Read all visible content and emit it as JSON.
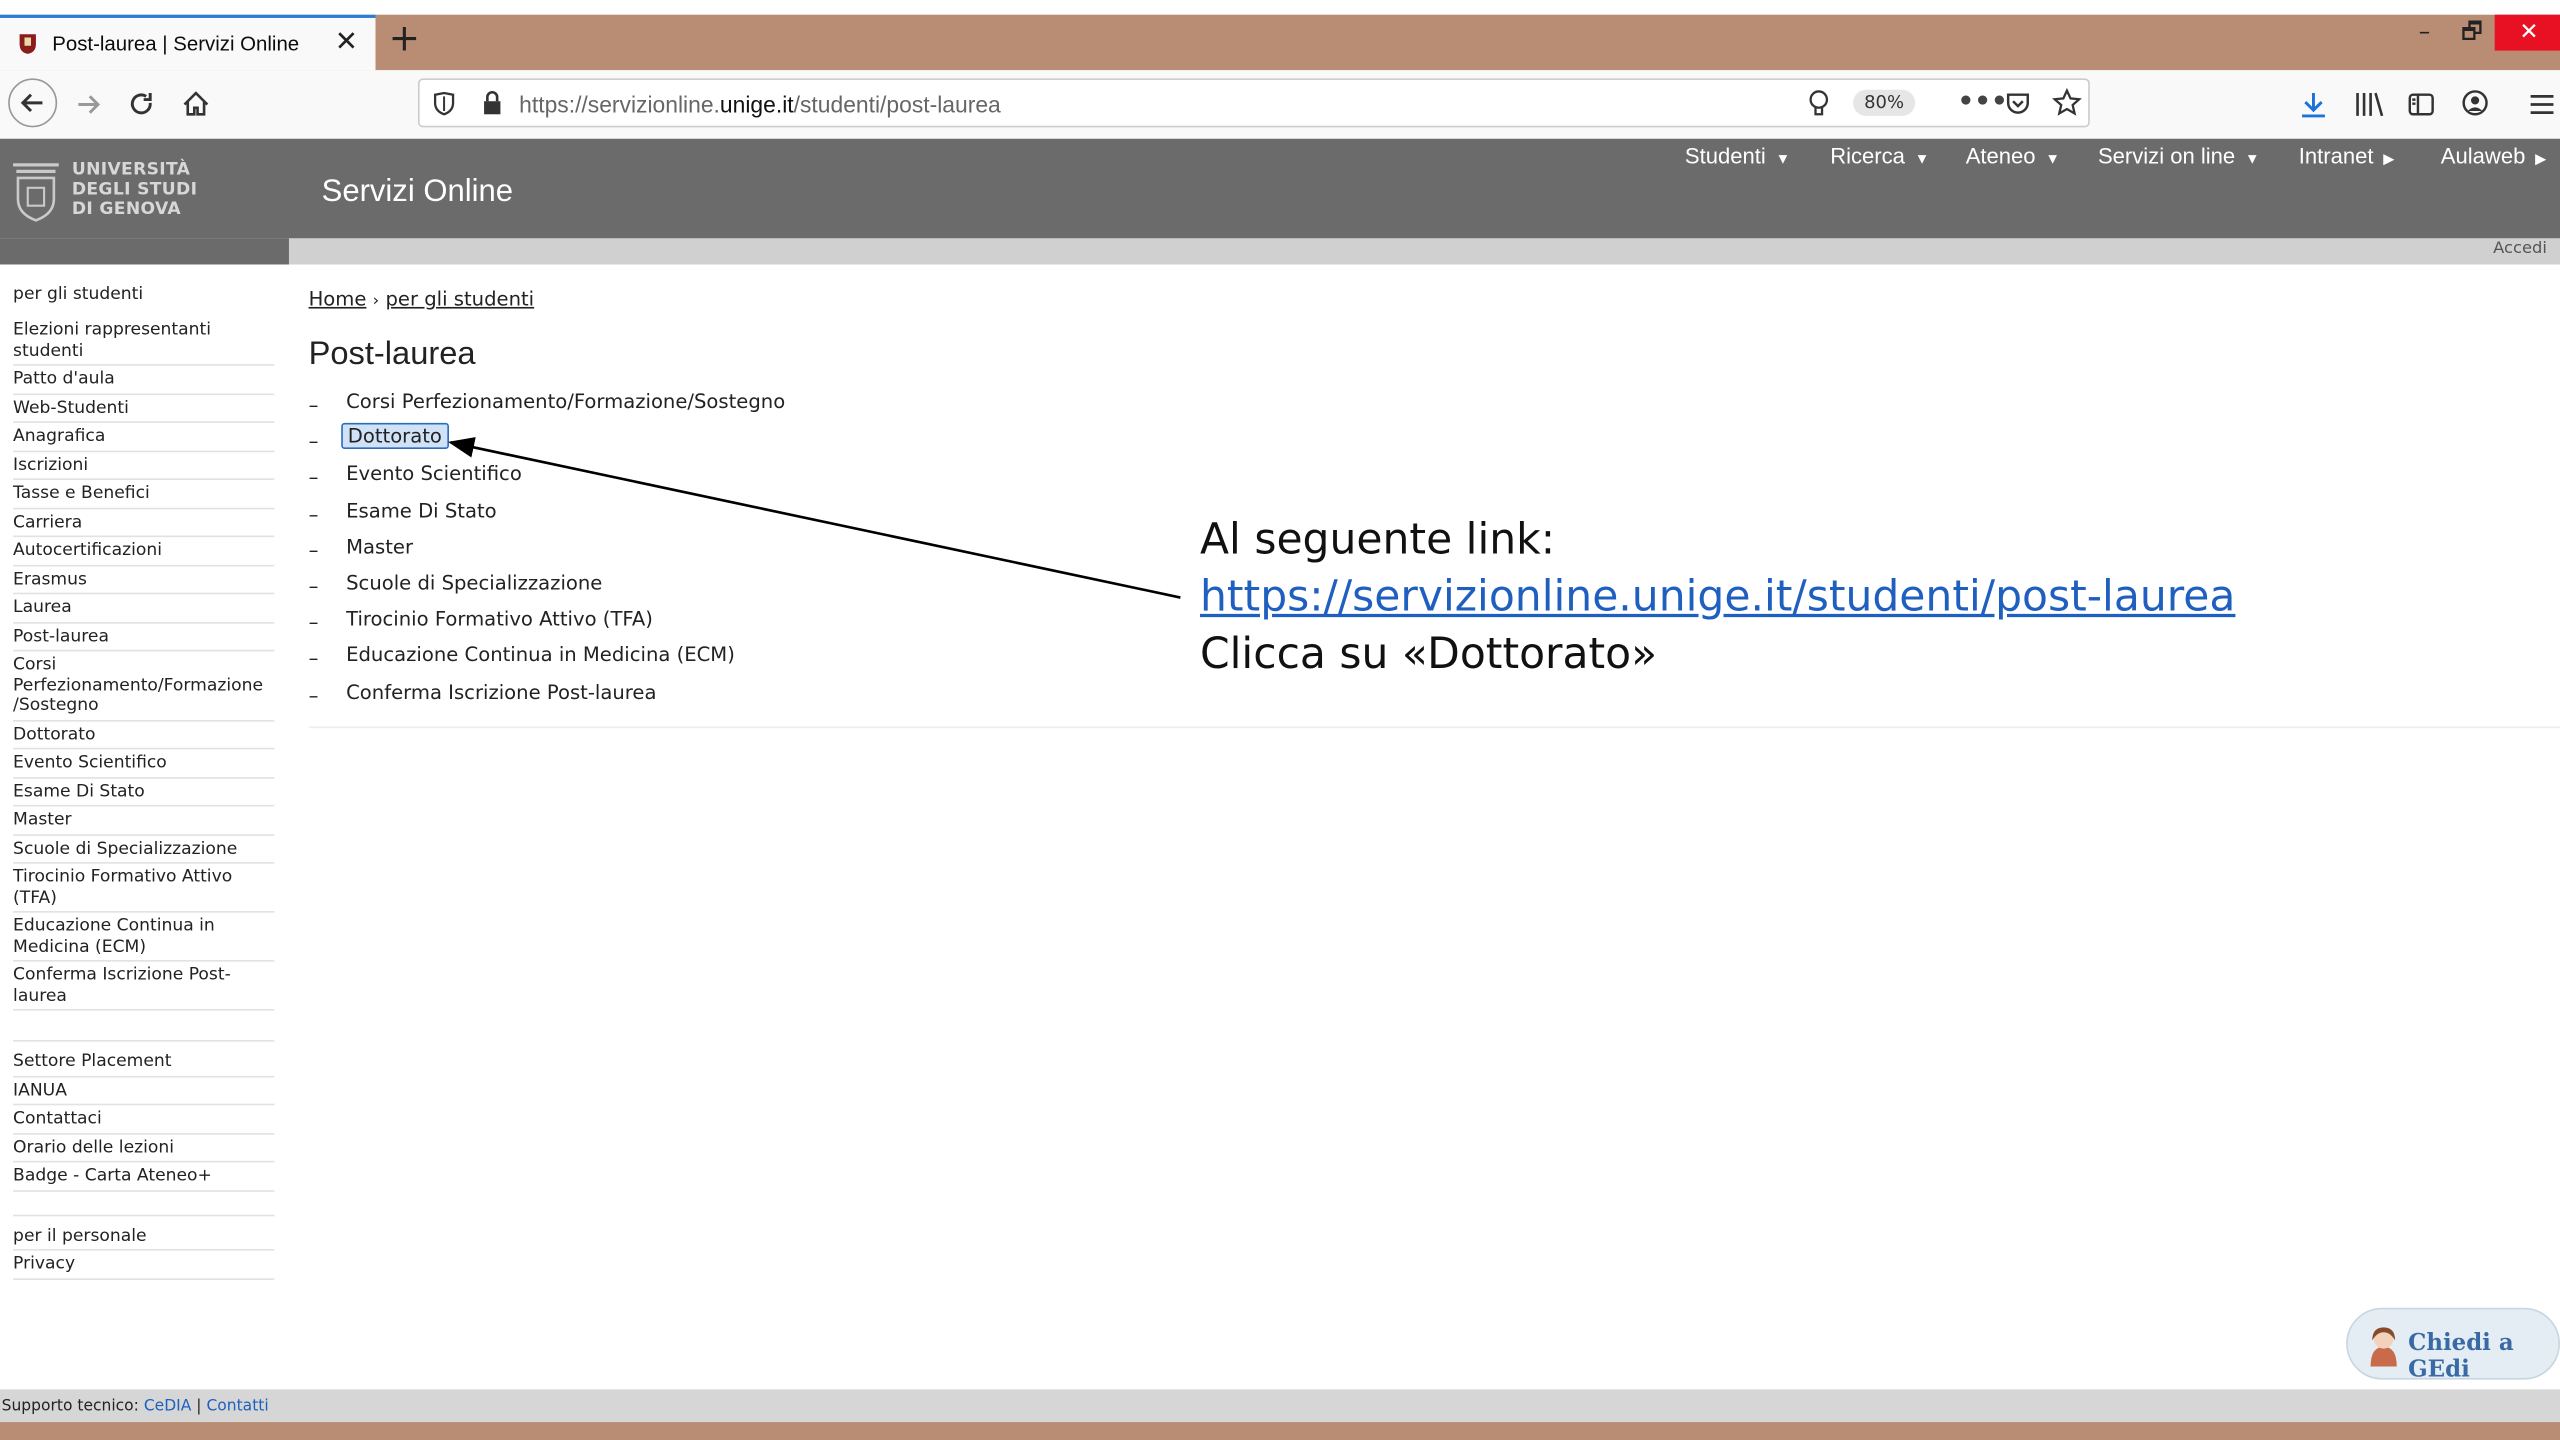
{
  "browser": {
    "tab_title": "Post-laurea | Servizi Online",
    "tab_close": "✕",
    "new_tab": "+",
    "url_prefix": "https://servizionline.",
    "url_domain": "unige.it",
    "url_path": "/studenti/post-laurea",
    "zoom": "80%",
    "win_minimize": "–",
    "win_restore": "🗗",
    "win_close": "✕"
  },
  "site": {
    "logo_line1": "UNIVERSITÀ",
    "logo_line2": "DEGLI STUDI",
    "logo_line3": "DI GENOVA",
    "title": "Servizi Online",
    "accedi": "Accedi",
    "topnav": [
      {
        "label": "Studenti"
      },
      {
        "label": "Ricerca"
      },
      {
        "label": "Ateneo"
      },
      {
        "label": "Servizi on line"
      },
      {
        "label": "Intranet"
      },
      {
        "label": "Aulaweb"
      }
    ]
  },
  "sidebar": {
    "section1": "per gli studenti",
    "group1": [
      "Elezioni rappresentanti studenti",
      "Patto d'aula",
      "Web-Studenti",
      "Anagrafica",
      "Iscrizioni",
      "Tasse e Benefici",
      "Carriera",
      "Autocertificazioni",
      "Erasmus",
      "Laurea",
      "Post-laurea",
      "Corsi Perfezionamento/Formazione /Sostegno",
      "Dottorato",
      "Evento Scientifico",
      "Esame Di Stato",
      "Master",
      "Scuole di Specializzazione",
      "Tirocinio Formativo Attivo (TFA)",
      "Educazione Continua in Medicina (ECM)",
      "Conferma Iscrizione Post-laurea"
    ],
    "group2": [
      "Settore Placement",
      "IANUA",
      "Contattaci",
      "Orario delle lezioni",
      "Badge - Carta Ateneo+"
    ],
    "group3": [
      "per il personale",
      "Privacy"
    ]
  },
  "main": {
    "crumb_home": "Home",
    "crumb_sep": "›",
    "crumb_current": "per gli studenti",
    "title": "Post-laurea",
    "bullet": "–",
    "items": [
      "Corsi Perfezionamento/Formazione/Sostegno",
      "Dottorato",
      "Evento Scientifico",
      "Esame Di Stato",
      "Master",
      "Scuole di Specializzazione",
      "Tirocinio Formativo Attivo (TFA)",
      "Educazione Continua in Medicina (ECM)",
      "Conferma Iscrizione Post-laurea"
    ]
  },
  "annotation": {
    "line1": "Al seguente link:",
    "link": "https://servizionline.unige.it/studenti/post-laurea",
    "line3": "Clicca su «Dottorato»"
  },
  "chat": {
    "label": "Chiedi a GEdi"
  },
  "footer": {
    "prefix": "Supporto tecnico: ",
    "link1": "CeDIA",
    "sep": " | ",
    "link2": "Contatti"
  }
}
